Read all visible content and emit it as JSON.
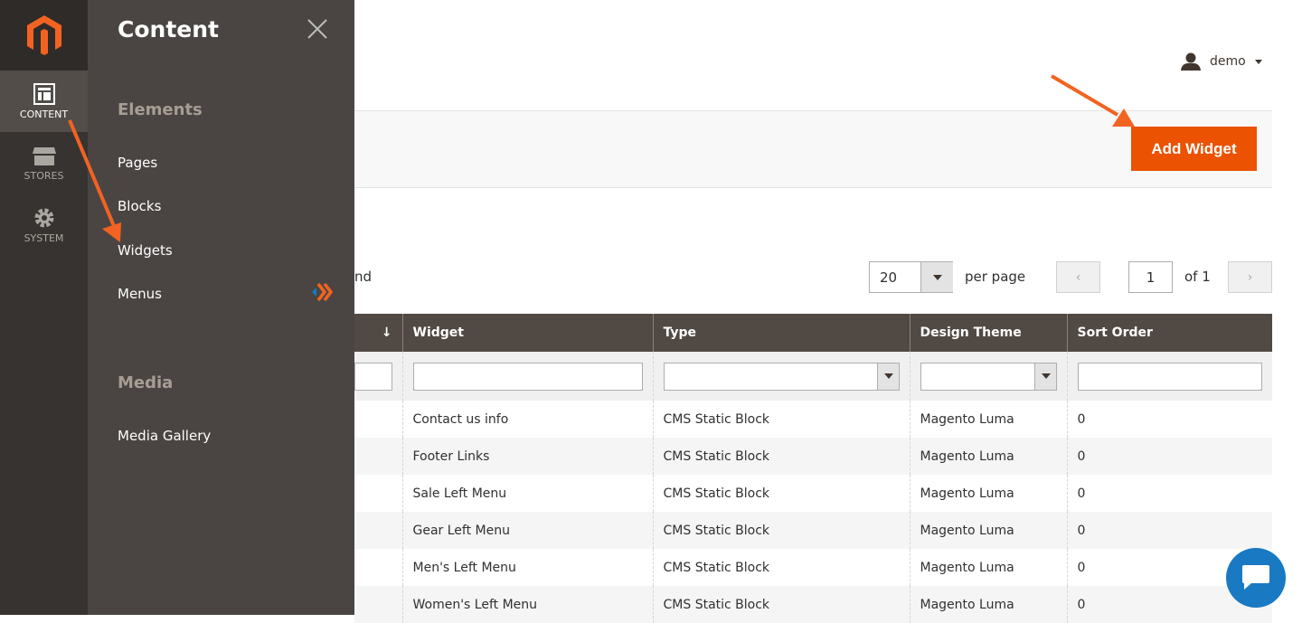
{
  "nav": {
    "items": [
      {
        "label": "CONTENT",
        "icon": "content-icon",
        "active": true
      },
      {
        "label": "STORES",
        "icon": "stores-icon"
      },
      {
        "label": "SYSTEM",
        "icon": "gear-icon"
      }
    ]
  },
  "panel": {
    "title": "Content",
    "sections": [
      {
        "title": "Elements",
        "items": [
          "Pages",
          "Blocks",
          "Widgets",
          "Menus"
        ]
      },
      {
        "title": "Media",
        "items": [
          "Media Gallery"
        ]
      }
    ]
  },
  "header": {
    "user": "demo",
    "add_button": "Add Widget"
  },
  "pager": {
    "records_fragment": "nd",
    "per_page_value": "20",
    "per_page_label": "per page",
    "page": "1",
    "of_label": "of 1"
  },
  "table": {
    "sort_indicator": "↓",
    "columns": [
      "Widget",
      "Type",
      "Design Theme",
      "Sort Order"
    ],
    "rows": [
      [
        "Contact us info",
        "CMS Static Block",
        "Magento Luma",
        "0"
      ],
      [
        "Footer Links",
        "CMS Static Block",
        "Magento Luma",
        "0"
      ],
      [
        "Sale Left Menu",
        "CMS Static Block",
        "Magento Luma",
        "0"
      ],
      [
        "Gear Left Menu",
        "CMS Static Block",
        "Magento Luma",
        "0"
      ],
      [
        "Men's Left Menu",
        "CMS Static Block",
        "Magento Luma",
        "0"
      ],
      [
        "Women's Left Menu",
        "CMS Static Block",
        "Magento Luma",
        "0"
      ]
    ]
  },
  "colors": {
    "accent": "#eb5202",
    "nav": "#373330",
    "panel": "#4a4542",
    "table_header": "#514943",
    "annotation_arrow": "#f26322",
    "chat": "#1979c3"
  }
}
